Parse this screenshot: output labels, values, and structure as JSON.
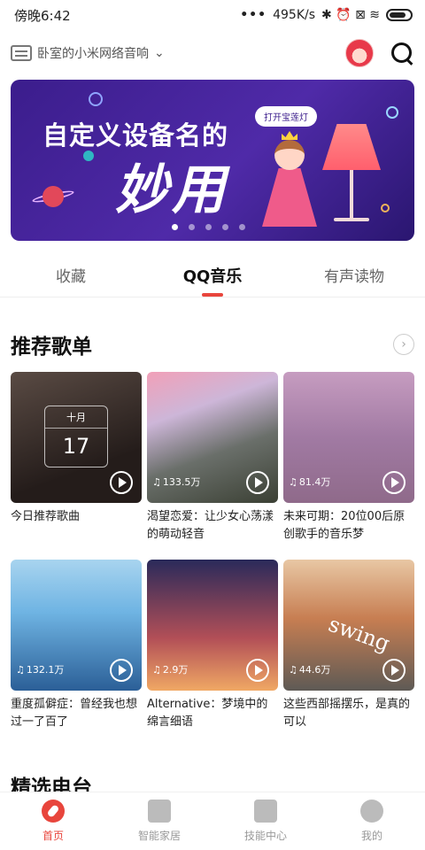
{
  "status": {
    "time": "傍晚6:42",
    "dots": "•••",
    "speed": "495K/s",
    "sys_icons": "✱ ⏰ ⊠ ≋"
  },
  "header": {
    "device_name": "卧室的小米网络音响",
    "chevron": "⌄"
  },
  "banner": {
    "line1": "自定义设备名的",
    "line2": "妙用",
    "tag": "打开宝莲灯"
  },
  "tabs": [
    {
      "label": "收藏"
    },
    {
      "label": "QQ音乐"
    },
    {
      "label": "有声读物"
    }
  ],
  "section1": {
    "title": "推荐歌单",
    "more": "›"
  },
  "playlists": [
    {
      "title": "今日推荐歌曲",
      "count": "",
      "cal_month": "十月",
      "cal_day": "17"
    },
    {
      "title": "渴望恋爱：让少女心荡漾的萌动轻音",
      "count": "133.5万"
    },
    {
      "title": "未来可期：20位00后原创歌手的音乐梦",
      "count": "81.4万"
    },
    {
      "title": "重度孤僻症：曾经我也想过一了百了",
      "count": "132.1万"
    },
    {
      "title": "Alternative：梦境中的绵言细语",
      "count": "2.9万"
    },
    {
      "title": "这些西部摇摆乐，是真的可以",
      "count": "44.6万",
      "overlay": "swing"
    }
  ],
  "section2": {
    "title": "精选电台"
  },
  "bottom_nav": [
    {
      "label": "首页",
      "icon": "home-icon"
    },
    {
      "label": "智能家居",
      "icon": "smart-home-icon"
    },
    {
      "label": "技能中心",
      "icon": "skills-icon"
    },
    {
      "label": "我的",
      "icon": "profile-icon"
    }
  ],
  "colors": {
    "accent": "#e8453c",
    "banner": "#4f2aa8"
  }
}
